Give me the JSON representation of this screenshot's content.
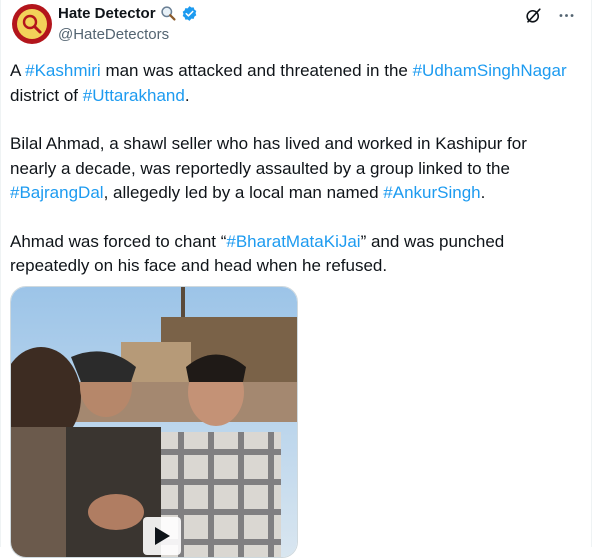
{
  "account": {
    "display_name": "Hate Detector",
    "handle": "@HateDetectors"
  },
  "tweet": {
    "p1": {
      "t1": "A ",
      "h1": "#Kashmiri",
      "t2": " man was attacked and threatened in the ",
      "h2": "#UdhamSinghNagar",
      "t3": " district of ",
      "h3": "#Uttarakhand",
      "t4": "."
    },
    "p2": {
      "t1": "Bilal Ahmad, a shawl seller who has lived and worked in Kashipur for nearly a decade, was reportedly assaulted by a group linked to the ",
      "h1": "#BajrangDal",
      "t2": ", allegedly led by a local man named ",
      "h2": "#AnkurSingh",
      "t3": "."
    },
    "p3": {
      "t1": "Ahmad was forced to chant “",
      "h1": "#BharatMataKiJai",
      "t2": "” and was punched repeatedly on his face and head when he refused."
    }
  },
  "icons": {
    "search": "magnifying-glass-icon",
    "verified": "verified-badge-icon",
    "grok": "grok-icon",
    "more": "more-icon",
    "play": "play-icon"
  },
  "colors": {
    "hashtag": "#1d9bf0",
    "text": "#0f1419",
    "muted": "#536471",
    "verified": "#1d9bf0"
  }
}
